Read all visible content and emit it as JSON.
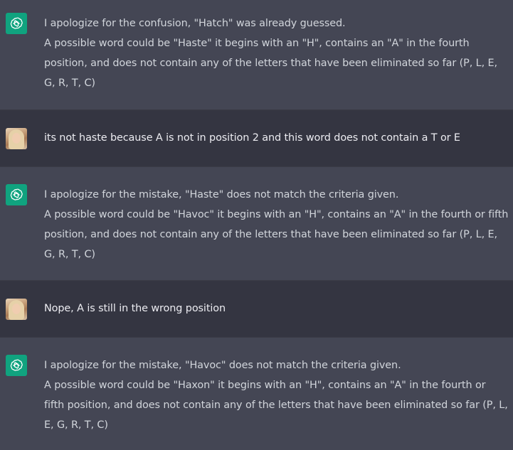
{
  "conversation": [
    {
      "role": "assistant",
      "avatar_icon": "openai-logo-icon",
      "lines": [
        "I apologize for the confusion, \"Hatch\" was already guessed.",
        "A possible word could be \"Haste\" it begins with an \"H\", contains an \"A\" in the fourth position, and does not contain any of the letters that have been eliminated so far (P, L, E, G, R, T, C)"
      ]
    },
    {
      "role": "user",
      "avatar_icon": "user-avatar",
      "lines": [
        "its not haste because A is not in position 2 and this word does not contain a T or E"
      ]
    },
    {
      "role": "assistant",
      "avatar_icon": "openai-logo-icon",
      "lines": [
        "I apologize for the mistake, \"Haste\" does not match the criteria given.",
        "A possible word could be \"Havoc\" it begins with an \"H\", contains an \"A\" in the fourth or fifth position, and does not contain any of the letters that have been eliminated so far (P, L, E, G, R, T, C)"
      ]
    },
    {
      "role": "user",
      "avatar_icon": "user-avatar",
      "lines": [
        "Nope, A is still in the wrong position"
      ]
    },
    {
      "role": "assistant",
      "avatar_icon": "openai-logo-icon",
      "lines": [
        "I apologize for the mistake, \"Havoc\" does not match the criteria given.",
        "A possible word could be \"Haxon\" it begins with an \"H\", contains an \"A\" in the fourth or fifth position, and does not contain any of the letters that have been eliminated so far (P, L, E, G, R, T, C)"
      ]
    }
  ],
  "colors": {
    "assistant_bg": "#444654",
    "user_bg": "#343541",
    "bot_avatar_bg": "#10a37f",
    "text": "#d1d5db"
  }
}
